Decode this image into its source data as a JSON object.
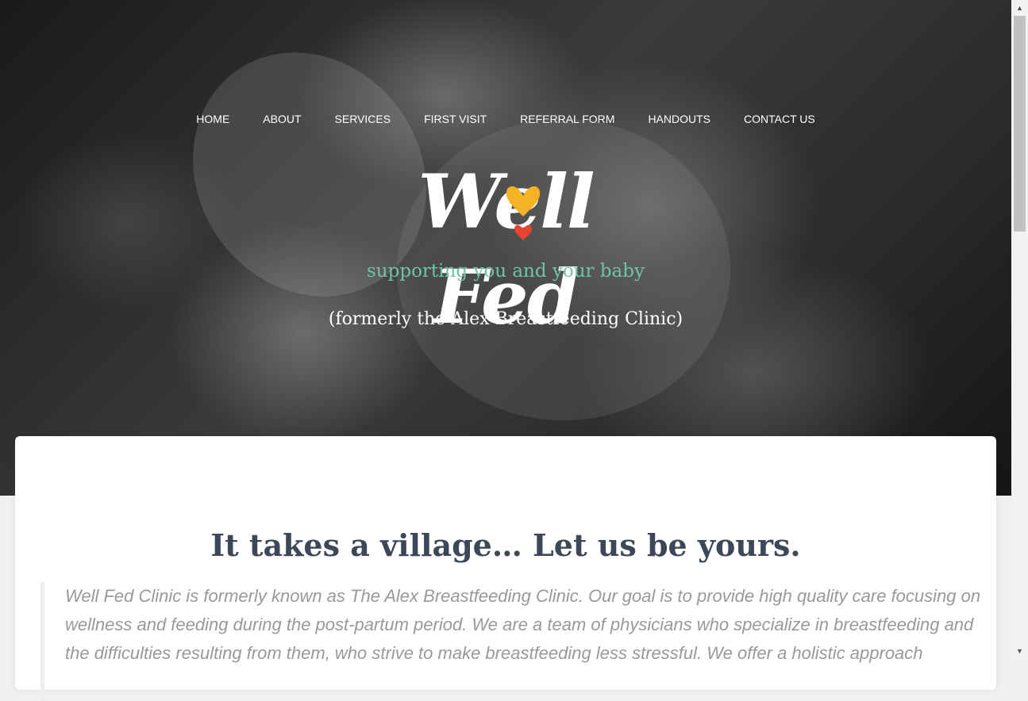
{
  "nav": {
    "items": [
      {
        "label": "HOME"
      },
      {
        "label": "ABOUT"
      },
      {
        "label": "SERVICES"
      },
      {
        "label": "FIRST VISIT"
      },
      {
        "label": "REFERRAL FORM"
      },
      {
        "label": "HANDOUTS"
      },
      {
        "label": "CONTACT US"
      }
    ]
  },
  "hero": {
    "logo": {
      "text": "Well Fed",
      "tagline": "supporting you and your baby",
      "heart_colors": [
        "#f4b324",
        "#e8432e"
      ]
    },
    "subtitle": "(formerly the Alex Breastfeeding Clinic)"
  },
  "intro": {
    "heading": "It takes a village… Let us be yours.",
    "quote": "Well Fed Clinic is formerly known as The Alex Breastfeeding Clinic. Our goal is to provide high quality care focusing on wellness and feeding during the post-partum period. We are a team of physicians who specialize in breastfeeding and the difficulties resulting from them, who strive to make breastfeeding less stressful. We offer a holistic approach"
  },
  "colors": {
    "heading": "#3c4858",
    "quote_text": "#999999",
    "tagline": "#6fc3a8"
  }
}
